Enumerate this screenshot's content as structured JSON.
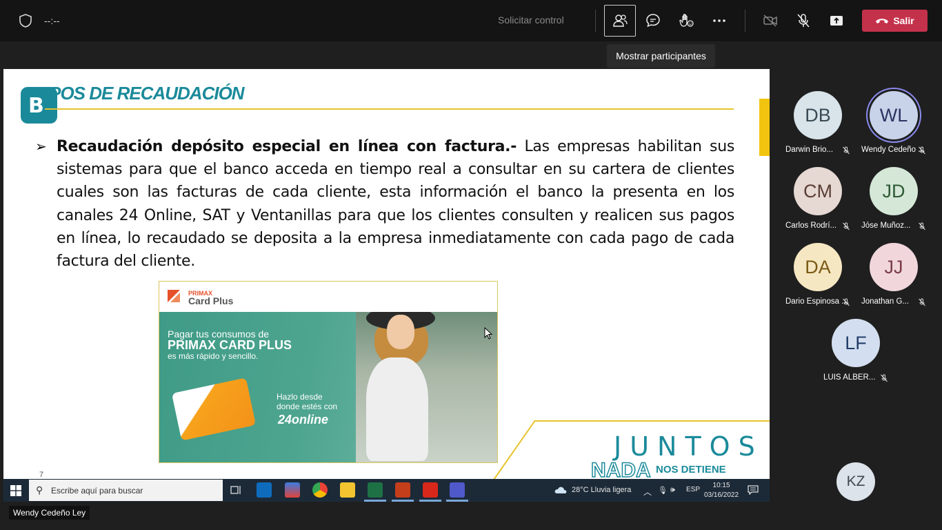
{
  "meeting": {
    "timer": "--:--",
    "request_control": "Solicitar control",
    "leave_label": "Salir",
    "tooltip": "Mostrar participantes"
  },
  "slide": {
    "title": "TIPOS DE RECAUDACIÓN",
    "bullet_bold": "Recaudación depósito especial en línea con factura.-",
    "bullet_text": " Las empresas habilitan sus sistemas para que el banco acceda en tiempo real a consultar en su cartera de clientes cuales son las facturas de cada cliente, esta información el banco la presenta en los canales 24 Online, SAT y Ventanillas para que los clientes consulten y realicen sus pagos en línea, lo recaudado se deposita a la empresa inmediatamente con cada pago de cada factura del cliente.",
    "slide_number": "7",
    "ad": {
      "brand_top": "PRIMAX",
      "brand": "Card Plus",
      "line1": "Pagar tus consumos de",
      "line2": "PRIMAX CARD PLUS",
      "line3": "es más rápido y sencillo.",
      "hazlo": "Hazlo desde\ndonde estés con",
      "online": "24online"
    },
    "slogan_top": "JUNTOS",
    "slogan_nada": "NADA",
    "slogan_rest": "NOS DETIENE"
  },
  "taskbar": {
    "search_placeholder": "Escribe aquí para buscar",
    "weather": "28°C  Lluvia ligera",
    "language": "ESP",
    "time": "10:15",
    "date": "03/16/2022"
  },
  "presenter": "Wendy Cedeño Ley",
  "participants": [
    {
      "initials": "DB",
      "name": "Darwin Brio...",
      "bg": "#d8e4ea",
      "fg": "#3a4a55"
    },
    {
      "initials": "WL",
      "name": "Wendy Cedeño ...",
      "bg": "#c8d3ea",
      "fg": "#2a3560"
    },
    {
      "initials": "CM",
      "name": "Carlos Rodrí...",
      "bg": "#e6d8d3",
      "fg": "#5a3e35"
    },
    {
      "initials": "JD",
      "name": "Jóse Muñoz...",
      "bg": "#d5e8d8",
      "fg": "#2f5a35"
    },
    {
      "initials": "DA",
      "name": "Dario Espinosa ...",
      "bg": "#f6e7c3",
      "fg": "#7a5a14"
    },
    {
      "initials": "JJ",
      "name": "Jonathan G...",
      "bg": "#f1d7dc",
      "fg": "#7a3c48"
    },
    {
      "initials": "LF",
      "name": "LUIS ALBER...",
      "bg": "#d3dff0",
      "fg": "#243e6a"
    },
    {
      "initials": "KZ",
      "name": "",
      "bg": "#dde3ea",
      "fg": "#3d4853"
    }
  ],
  "colors": {
    "leave": "#c4314b",
    "accent_teal": "#1a8a9a",
    "accent_yellow": "#e6c32c"
  }
}
